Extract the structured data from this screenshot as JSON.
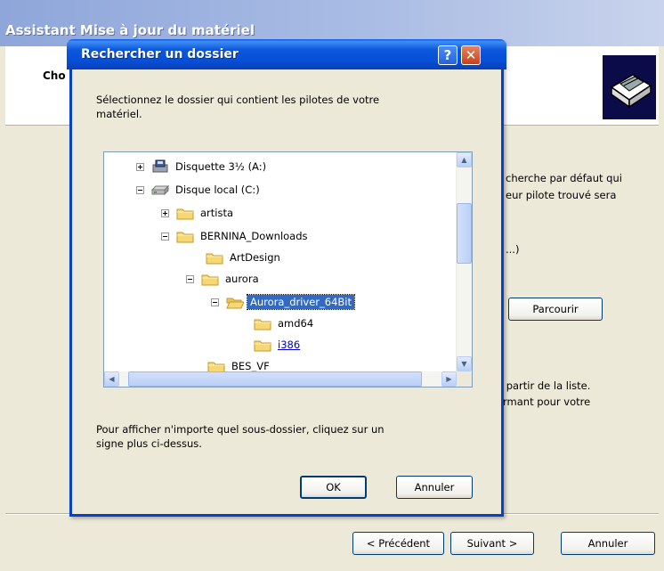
{
  "wizard": {
    "title": "Assistant Mise à jour du matériel",
    "header_title": "Cho",
    "right_text_1": "cherche par défaut qui",
    "right_text_2": "eur pilote trouvé sera",
    "right_text_3": "...)",
    "browse_label": "Parcourir",
    "right_text_4": "à partir de la liste.",
    "right_text_5": "ormant pour votre",
    "back_label": "< Précédent",
    "next_label": "Suivant >",
    "cancel_label": "Annuler"
  },
  "dialog": {
    "title": "Rechercher un dossier",
    "help_glyph": "?",
    "close_glyph": "✕",
    "prompt": "Sélectionnez le dossier qui contient les pilotes de votre\nmatériel.",
    "hint": "Pour afficher n'importe quel sous-dossier, cliquez sur un\nsigne plus ci-dessus.",
    "ok_label": "OK",
    "cancel_label": "Annuler"
  },
  "tree": {
    "items": [
      {
        "label": "Disquette 3½ (A:)",
        "icon": "floppy-drive-icon",
        "expander": "plus"
      },
      {
        "label": "Disque local (C:)",
        "icon": "hard-drive-icon",
        "expander": "minus"
      },
      {
        "label": "artista",
        "icon": "folder-icon",
        "expander": "plus"
      },
      {
        "label": "BERNINA_Downloads",
        "icon": "folder-icon",
        "expander": "minus"
      },
      {
        "label": "ArtDesign",
        "icon": "folder-icon",
        "expander": "none"
      },
      {
        "label": "aurora",
        "icon": "folder-icon",
        "expander": "minus"
      },
      {
        "label": "Aurora_driver_64Bit",
        "icon": "folder-open-icon",
        "expander": "minus",
        "selected": true
      },
      {
        "label": "amd64",
        "icon": "folder-icon",
        "expander": "none"
      },
      {
        "label": "i386",
        "icon": "folder-icon",
        "expander": "none",
        "hover": true
      },
      {
        "label": "BES_VF",
        "icon": "folder-icon",
        "expander": "none"
      }
    ]
  },
  "colors": {
    "title_bar": "#0650D8",
    "selection": "#316AC5",
    "dialog_bg": "#ECE9D8"
  }
}
